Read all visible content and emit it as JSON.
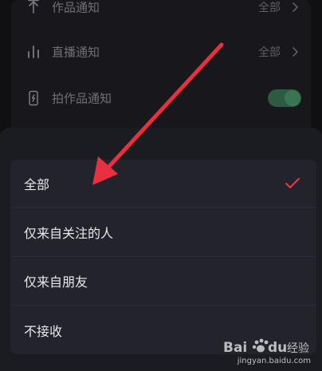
{
  "settings": {
    "rows": [
      {
        "label": "作品通知",
        "value": "全部",
        "icon": "upload-arrow-icon"
      },
      {
        "label": "直播通知",
        "value": "全部",
        "icon": "live-bars-icon"
      },
      {
        "label": "拍作品通知",
        "toggle_on": true,
        "icon": "phone-camera-icon"
      }
    ]
  },
  "sheet": {
    "options": [
      {
        "label": "全部",
        "selected": true
      },
      {
        "label": "仅来自关注的人",
        "selected": false
      },
      {
        "label": "仅来自朋友",
        "selected": false
      },
      {
        "label": "不接收",
        "selected": false
      }
    ]
  },
  "watermark": {
    "text": "jingyan.baidu.com"
  },
  "colors": {
    "accent_red": "#f0364f",
    "toggle_green": "#3a7553",
    "arrow_red": "#e8303f"
  }
}
